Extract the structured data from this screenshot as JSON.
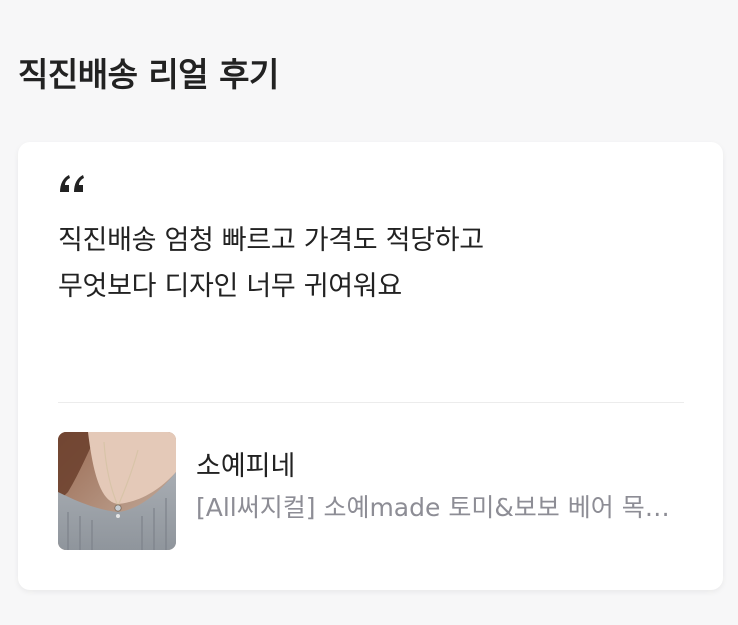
{
  "section": {
    "title": "직진배송 리얼 후기"
  },
  "review": {
    "quote_icon": "quote-icon",
    "lines": [
      "직진배송 엄청 빠르고 가격도 적당하고",
      "무엇보다 디자인 너무 귀여워요"
    ],
    "product": {
      "brand": "소예피네",
      "name": "[All써지컬] 소예made 토미&보보 베어 목걸이",
      "thumbnail_icon": "product-photo-necklace"
    }
  },
  "colors": {
    "background": "#f7f7f8",
    "card": "#ffffff",
    "text": "#222222",
    "muted": "#8d8d95"
  }
}
